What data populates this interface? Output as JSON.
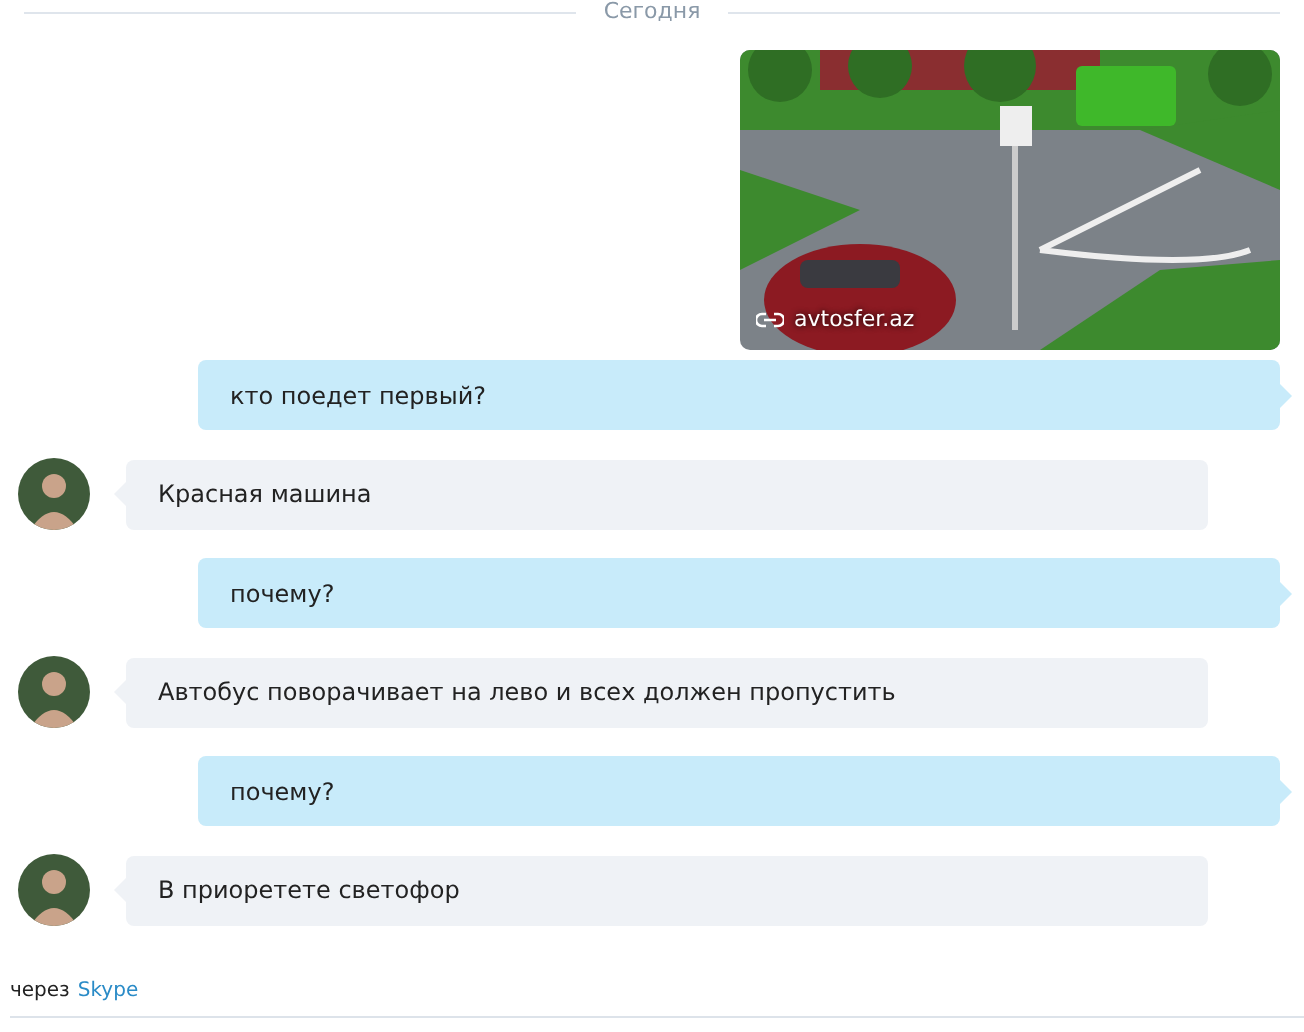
{
  "date_divider": "Сегодня",
  "messages": [
    {
      "outgoing": true,
      "caption": "avtosfer.az"
    },
    {
      "kind": "text",
      "outgoing": true,
      "text": "кто поедет первый?"
    },
    {
      "kind": "text",
      "outgoing": false,
      "text": "Красная машина"
    },
    {
      "kind": "text",
      "outgoing": true,
      "text": "почему?"
    },
    {
      "kind": "text",
      "outgoing": false,
      "text": "Автобус поворачивает на лево и всех должен пропустить"
    },
    {
      "kind": "text",
      "outgoing": true,
      "text": "почему?"
    },
    {
      "kind": "text",
      "outgoing": false,
      "text": "В приоретете светофор"
    }
  ],
  "footer": {
    "prefix": "через",
    "link": "Skype"
  }
}
